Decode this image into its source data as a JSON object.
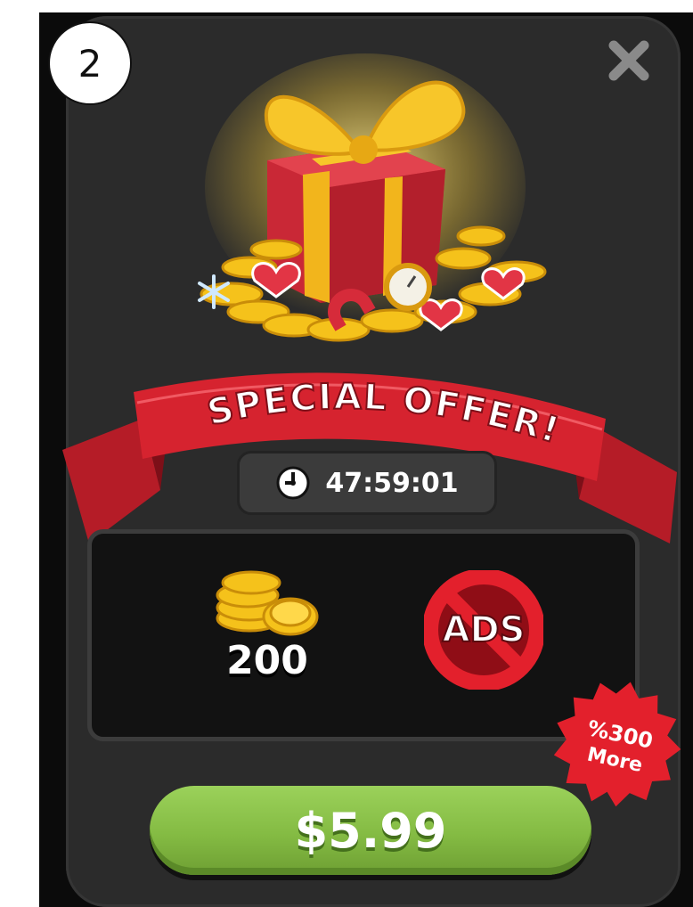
{
  "step_badge": "2",
  "offer": {
    "title": "SPECIAL OFFER!",
    "timer": "47:59:01"
  },
  "rewards": {
    "coins_amount": "200",
    "no_ads_label": "ADS"
  },
  "bonus_badge": {
    "line1": "%300",
    "line2": "More"
  },
  "buy_button": {
    "price_label": "$5.99"
  },
  "icons": {
    "close": "close-icon",
    "timer": "clock-icon",
    "coins": "coin-stack-icon",
    "no_ads": "no-ads-icon",
    "gift": "gift-box-icon"
  },
  "colors": {
    "panel": "#2b2b2b",
    "ribbon": "#d6232f",
    "button": "#8bc34a",
    "coin": "#f5c21b",
    "badge": "#e3202c"
  }
}
